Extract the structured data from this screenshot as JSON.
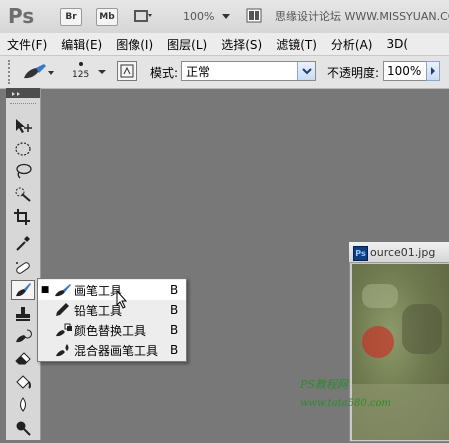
{
  "app": {
    "logo": "Ps"
  },
  "appbar": {
    "buttons": [
      "Br",
      "Mb"
    ],
    "zoom": "100%",
    "watermark": "思缘设计论坛  WWW.MISSYUAN.COM"
  },
  "menubar": {
    "items": [
      "文件(F)",
      "编辑(E)",
      "图像(I)",
      "图层(L)",
      "选择(S)",
      "滤镜(T)",
      "分析(A)",
      "3D("
    ]
  },
  "options": {
    "brush_size": "125",
    "mode_label": "模式:",
    "mode_value": "正常",
    "opacity_label": "不透明度:",
    "opacity_value": "100%"
  },
  "toolbox": {
    "tools": [
      "move-tool",
      "ellipse-marquee-tool",
      "lasso-tool",
      "quick-selection-tool",
      "crop-tool",
      "eyedropper-tool",
      "spot-healing-tool",
      "brush-tool",
      "clone-stamp-tool",
      "history-brush-tool",
      "eraser-tool",
      "paint-bucket-tool",
      "blur-tool",
      "dodge-tool"
    ]
  },
  "flyout": {
    "items": [
      {
        "label": "画笔工具",
        "key": "B",
        "selected": true,
        "icon": "brush-icon"
      },
      {
        "label": "铅笔工具",
        "key": "B",
        "selected": false,
        "icon": "pencil-icon"
      },
      {
        "label": "颜色替换工具",
        "key": "B",
        "selected": false,
        "icon": "color-replacement-icon"
      },
      {
        "label": "混合器画笔工具",
        "key": "B",
        "selected": false,
        "icon": "mixer-brush-icon"
      }
    ]
  },
  "document": {
    "title": "ource01.jpg"
  },
  "site_watermark": {
    "line1": "PS教程网",
    "line2": "www.tata580.com"
  },
  "colors": {
    "workspace": "#787878",
    "accent_blue": "#3a78c8",
    "watermark_green": "#2e8a2e"
  }
}
